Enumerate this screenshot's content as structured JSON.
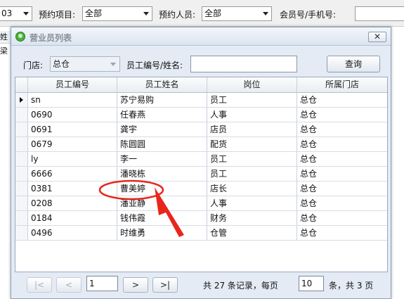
{
  "background": {
    "period_value": "03",
    "project_label": "预约项目:",
    "project_value": "全部",
    "person_label": "预约人员:",
    "person_value": "全部",
    "member_label": "会员号/手机号:",
    "left_cell_1": "姓名",
    "left_cell_2": "梁晓"
  },
  "dialog": {
    "title": "营业员列表",
    "close_label": "✕",
    "store_label": "门店:",
    "store_value": "总仓",
    "search_label": "员工编号/姓名:",
    "search_value": "",
    "query_label": "查询"
  },
  "grid": {
    "columns": [
      "员工编号",
      "员工姓名",
      "岗位",
      "所属门店"
    ],
    "rows": [
      [
        "sn",
        "苏宁易购",
        "员工",
        "总仓"
      ],
      [
        "0690",
        "任春燕",
        "人事",
        "总仓"
      ],
      [
        "0691",
        "龚宇",
        "店员",
        "总仓"
      ],
      [
        "0679",
        "陈圆圆",
        "配货",
        "总仓"
      ],
      [
        "ly",
        "李一",
        "员工",
        "总仓"
      ],
      [
        "6666",
        "潘晓栋",
        "员工",
        "总仓"
      ],
      [
        "0381",
        "曹美婷",
        "店长",
        "总仓"
      ],
      [
        "0208",
        "潘亚静",
        "人事",
        "总仓"
      ],
      [
        "0184",
        "钱伟霞",
        "财务",
        "总仓"
      ],
      [
        "0496",
        "时维勇",
        "仓管",
        "总仓"
      ]
    ]
  },
  "pager": {
    "first_label": "|<",
    "prev_label": "<",
    "page_value": "1",
    "next_label": ">",
    "last_label": ">|",
    "records_text": "共 27 条记录，每页",
    "page_size_value": "10",
    "pages_text": "条，共 3 页"
  },
  "colors": {
    "annotation": "#e8261c"
  }
}
